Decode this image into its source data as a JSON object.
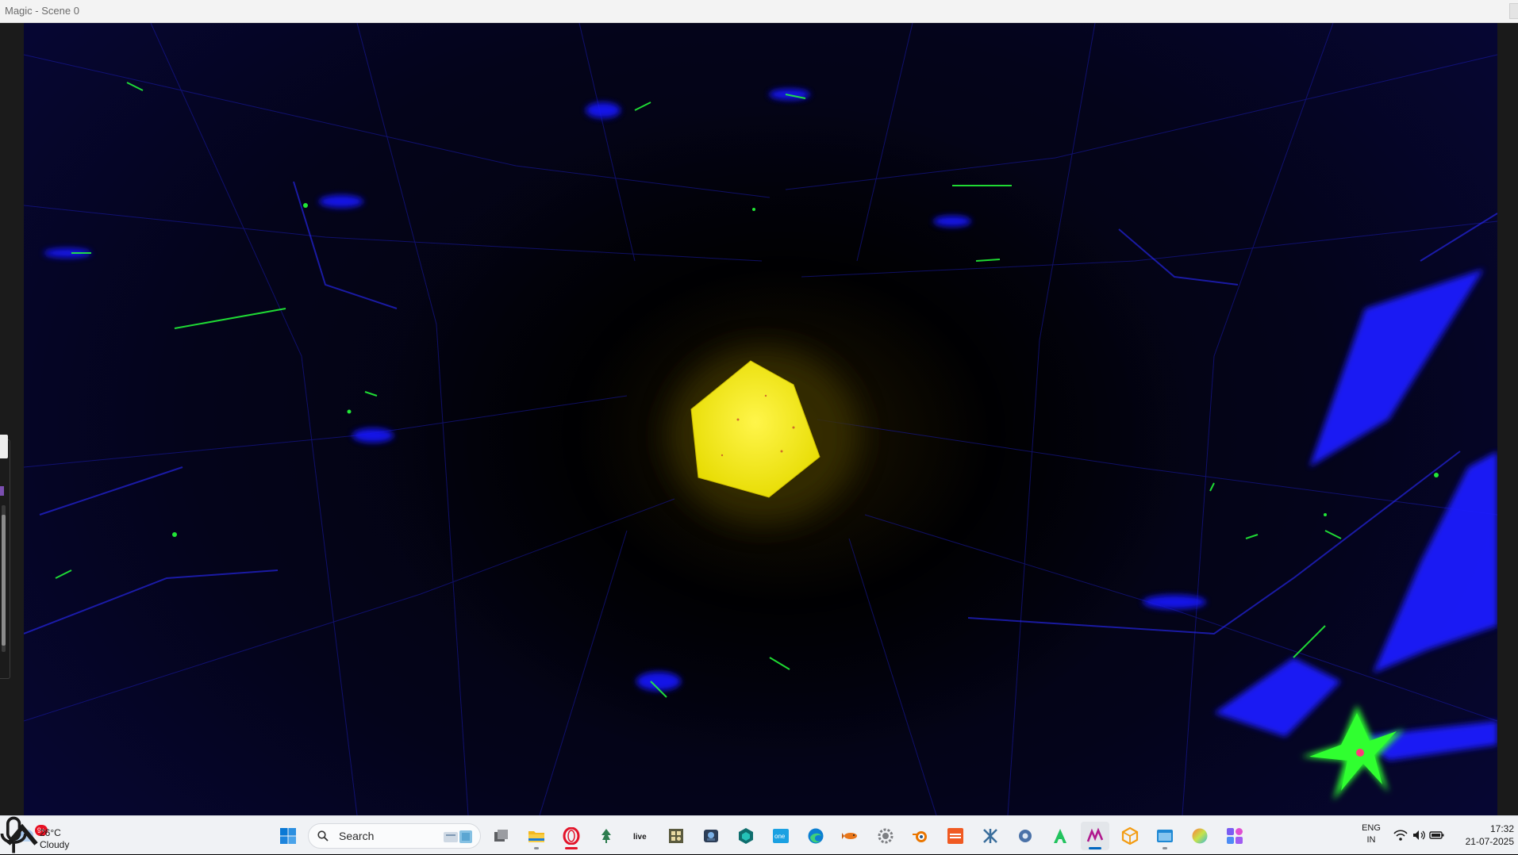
{
  "window": {
    "title": "Magic - Scene 0"
  },
  "viewport": {
    "scene": "3d-render",
    "object_color": "#f6ee12",
    "accent_colors": [
      "#1a1aff",
      "#23ff3a",
      "#000000"
    ]
  },
  "taskbar": {
    "weather": {
      "temperature": "26°C",
      "condition": "Cloudy",
      "badge": "9+"
    },
    "search": {
      "placeholder": "Search"
    },
    "apps": [
      {
        "name": "start-icon"
      },
      {
        "name": "task-view-icon"
      },
      {
        "name": "file-explorer-icon"
      },
      {
        "name": "opera-browser-icon"
      },
      {
        "name": "app-tree-icon"
      },
      {
        "name": "live-icon",
        "label": "live"
      },
      {
        "name": "app-grid-icon"
      },
      {
        "name": "app-photo-icon"
      },
      {
        "name": "app-hex-icon"
      },
      {
        "name": "app-blue-label-icon",
        "label": "one"
      },
      {
        "name": "edge-browser-icon"
      },
      {
        "name": "app-fish-icon"
      },
      {
        "name": "settings-gear-icon"
      },
      {
        "name": "blender-icon"
      },
      {
        "name": "app-orange-icon"
      },
      {
        "name": "app-x-icon"
      },
      {
        "name": "app-settings-icon"
      },
      {
        "name": "app-a-icon"
      },
      {
        "name": "magic-app-icon"
      },
      {
        "name": "app-box-icon"
      },
      {
        "name": "app-window-icon"
      },
      {
        "name": "app-gradient-icon"
      },
      {
        "name": "app-purple-icon"
      }
    ],
    "tray": {
      "language_top": "ENG",
      "language_bottom": "IN",
      "time": "17:32",
      "date": "21-07-2025"
    }
  }
}
